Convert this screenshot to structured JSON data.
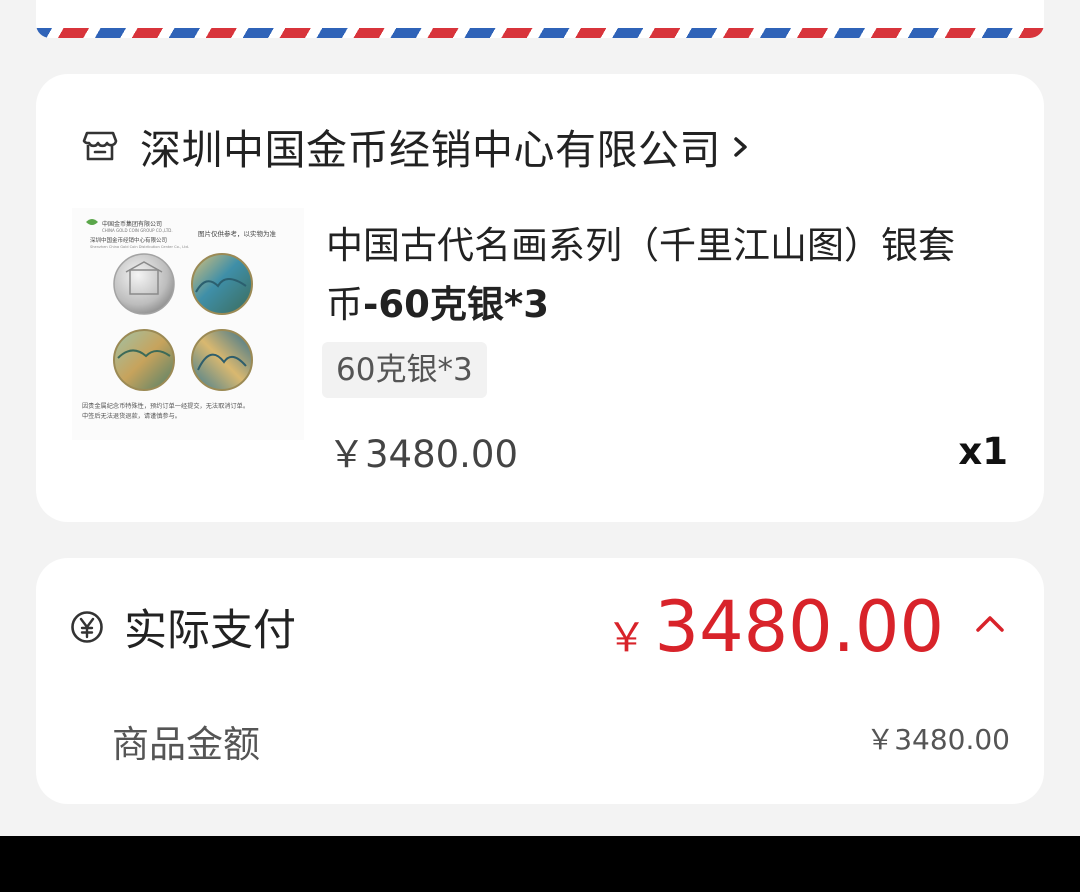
{
  "shop": {
    "name": "深圳中国金币经销中心有限公司"
  },
  "product": {
    "title_main": "中国古代名画系列（千里江山图）银套币",
    "title_suffix": "-60克银*3",
    "spec": "60克银*3",
    "unit_price": "￥3480.00",
    "quantity": "x1",
    "thumbnail": {
      "company_cn": "中国金币集团有限公司",
      "company_en": "CHINA GOLD COIN GROUP CO.,LTD.",
      "distributor_cn": "深圳中国金币经销中心有限公司",
      "distributor_en": "Shenzhen China Gold Coin Distribution Center Co., Ltd.",
      "note": "图片仅供参考，以实物为准",
      "disclaimer_1": "因贵金属纪念币特殊性，预约订单一经提交，无法取消订单。",
      "disclaimer_2": "中签后无法退货退款，请谨慎参与。"
    }
  },
  "payment": {
    "label": "实际支付",
    "currency_symbol": "￥",
    "amount": "3480.00",
    "subtotal_label": "商品金额",
    "subtotal_value": "￥3480.00"
  },
  "colors": {
    "price_red": "#d8232a",
    "airmail_red": "#d8343b",
    "airmail_blue": "#2f63b8"
  },
  "icons": {
    "shop": "store-icon",
    "shop_chevron": "chevron-right-icon",
    "payment": "yen-coin-icon",
    "expand": "chevron-up-icon"
  }
}
